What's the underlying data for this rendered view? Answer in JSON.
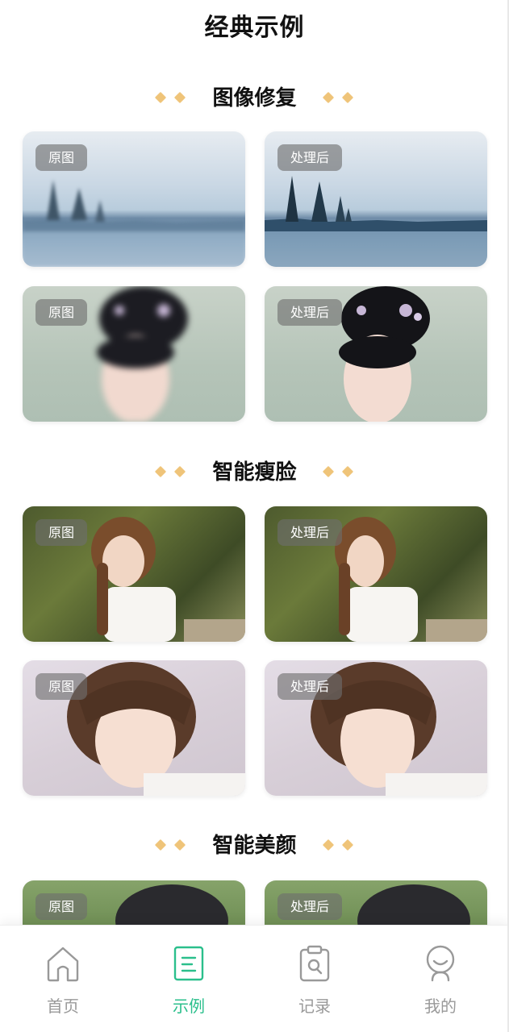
{
  "header": {
    "title": "经典示例"
  },
  "sections": [
    {
      "title": "图像修复",
      "rows": [
        {
          "before": "原图",
          "after": "处理后"
        },
        {
          "before": "原图",
          "after": "处理后"
        }
      ]
    },
    {
      "title": "智能瘦脸",
      "rows": [
        {
          "before": "原图",
          "after": "处理后"
        },
        {
          "before": "原图",
          "after": "处理后"
        }
      ]
    },
    {
      "title": "智能美颜",
      "rows": [
        {
          "before": "原图",
          "after": "处理后"
        }
      ]
    }
  ],
  "tabbar": {
    "items": [
      {
        "label": "首页",
        "icon": "home-icon"
      },
      {
        "label": "示例",
        "icon": "document-icon",
        "active": true
      },
      {
        "label": "记录",
        "icon": "clipboard-search-icon"
      },
      {
        "label": "我的",
        "icon": "user-icon"
      }
    ]
  },
  "colors": {
    "accent": "#2bbf8c",
    "diamond": "#efc479",
    "tab_inactive": "#999999"
  }
}
